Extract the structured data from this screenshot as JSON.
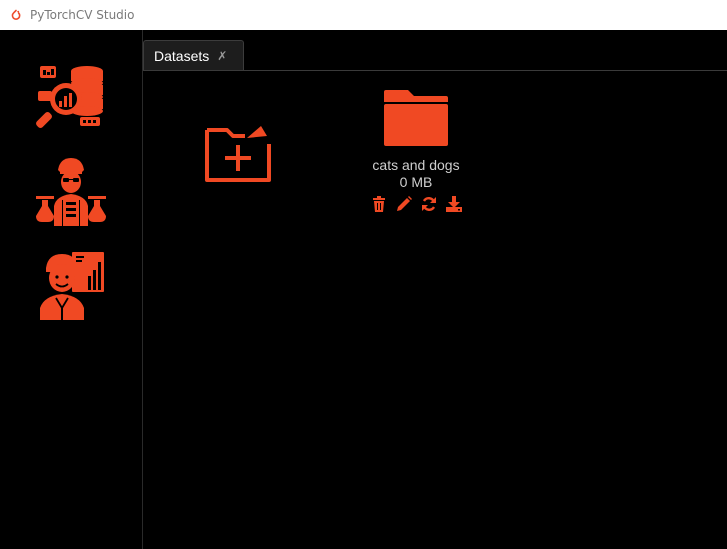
{
  "window": {
    "title": "PyTorchCV Studio",
    "accent_color": "#f04923"
  },
  "sidebar": {
    "items": [
      {
        "icon": "data-analysis-icon"
      },
      {
        "icon": "scientist-icon"
      },
      {
        "icon": "presenter-chart-icon"
      }
    ]
  },
  "tabs": [
    {
      "label": "Datasets",
      "close_icon": "✗",
      "active": true
    }
  ],
  "datasets_panel": {
    "new_dataset_icon": "folder-add-icon",
    "items": [
      {
        "name": "cats and dogs",
        "size": "0 MB",
        "actions": [
          "delete-icon",
          "edit-icon",
          "refresh-icon",
          "download-icon"
        ]
      }
    ]
  }
}
